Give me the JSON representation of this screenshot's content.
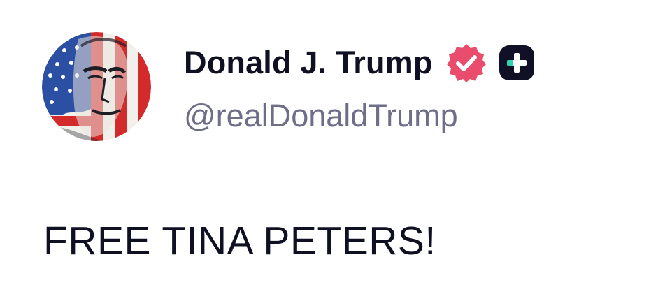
{
  "author": {
    "display_name": "Donald J. Trump",
    "handle": "@realDonaldTrump",
    "verified_badge_color": "#ea4c6d",
    "plus_badge_color": "#101027",
    "plus_badge_accent": "#2fd3b0"
  },
  "post": {
    "text": "FREE TINA PETERS!"
  },
  "icons": {
    "avatar": "profile-avatar",
    "verified": "verified-check-icon",
    "plus": "plus-badge-icon"
  }
}
